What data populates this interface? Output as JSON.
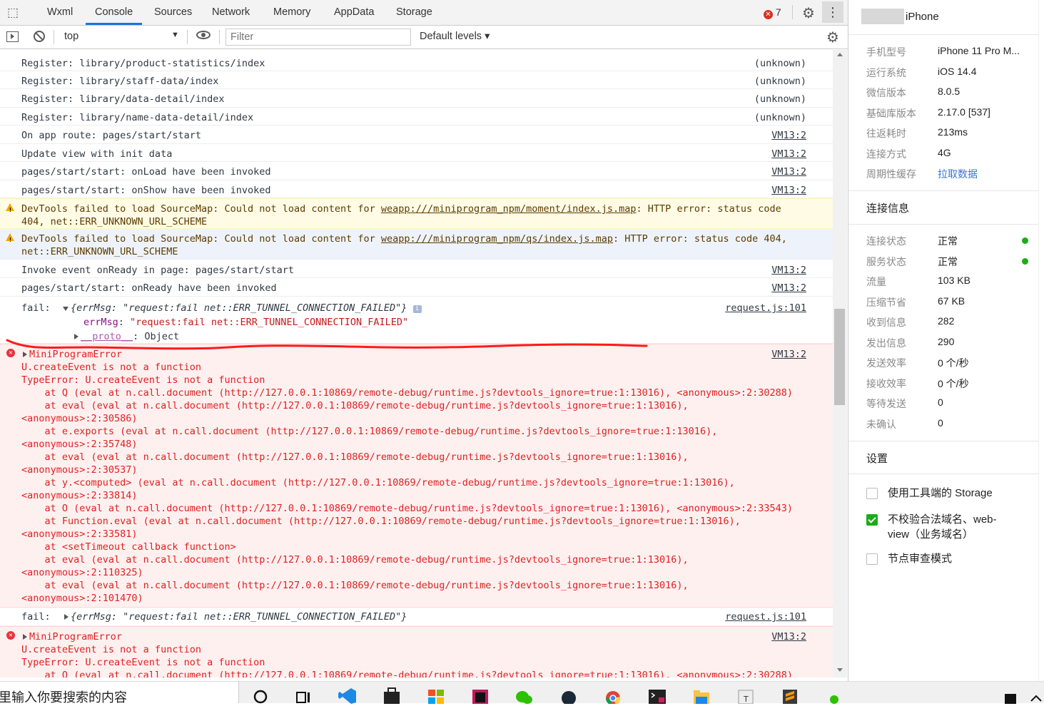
{
  "tabs": [
    "Wxml",
    "Console",
    "Sources",
    "Network",
    "Memory",
    "AppData",
    "Storage"
  ],
  "active_tab": "Console",
  "error_count": "7",
  "toolbar": {
    "context": "top",
    "filter_placeholder": "Filter",
    "levels": "Default levels"
  },
  "rows": {
    "r1": {
      "msg": "Register: library/product-statistics/index",
      "src": "(unknown)"
    },
    "r2": {
      "msg": "Register: library/staff-data/index",
      "src": "(unknown)"
    },
    "r3": {
      "msg": "Register: library/data-detail/index",
      "src": "(unknown)"
    },
    "r4": {
      "msg": "Register: library/name-data-detail/index",
      "src": "(unknown)"
    },
    "r5": {
      "msg": "On app route: pages/start/start",
      "src": "VM13:2"
    },
    "r6": {
      "msg": "Update view with init data",
      "src": "VM13:2"
    },
    "r7": {
      "msg": "pages/start/start: onLoad have been invoked",
      "src": "VM13:2"
    },
    "r8": {
      "msg": "pages/start/start: onShow have been invoked",
      "src": "VM13:2"
    },
    "w1": {
      "pre": "DevTools failed to load SourceMap: Could not load content for ",
      "link": "weapp:///miniprogram_npm/moment/index.js.map",
      "post": ": HTTP error: status code",
      "line2": "404, net::ERR_UNKNOWN_URL_SCHEME"
    },
    "w2": {
      "pre": "DevTools failed to load SourceMap: Could not load content for ",
      "link": "weapp:///miniprogram_npm/qs/index.js.map",
      "post": ": HTTP error: status code 404,",
      "line2": "net::ERR_UNKNOWN_URL_SCHEME"
    },
    "r9": {
      "msg": "Invoke event onReady in page: pages/start/start",
      "src": "VM13:2"
    },
    "r10": {
      "msg": "pages/start/start: onReady have been invoked",
      "src": "VM13:2"
    },
    "fail1": {
      "label": "fail:",
      "summary": "{errMsg: \"request:fail net::ERR_TUNNEL_CONNECTION_FAILED\"}",
      "key": "errMsg",
      "value": "\"request:fail net::ERR_TUNNEL_CONNECTION_FAILED\"",
      "proto": "__proto__",
      "proto_val": ": Object",
      "info": "i",
      "src": "request.js:101"
    },
    "err1": {
      "title": "MiniProgramError",
      "src": "VM13:2",
      "lines": [
        "U.createEvent is not a function",
        "TypeError: U.createEvent is not a function",
        "    at Q (eval at n.call.document (http://127.0.0.1:10869/remote-debug/runtime.js?devtools_ignore=true:1:13016), <anonymous>:2:30288)",
        "    at eval (eval at n.call.document (http://127.0.0.1:10869/remote-debug/runtime.js?devtools_ignore=true:1:13016),",
        "<anonymous>:2:30586)",
        "    at e.exports (eval at n.call.document (http://127.0.0.1:10869/remote-debug/runtime.js?devtools_ignore=true:1:13016),",
        "<anonymous>:2:35748)",
        "    at eval (eval at n.call.document (http://127.0.0.1:10869/remote-debug/runtime.js?devtools_ignore=true:1:13016),",
        "<anonymous>:2:30537)",
        "    at y.<computed> (eval at n.call.document (http://127.0.0.1:10869/remote-debug/runtime.js?devtools_ignore=true:1:13016),",
        "<anonymous>:2:33814)",
        "    at O (eval at n.call.document (http://127.0.0.1:10869/remote-debug/runtime.js?devtools_ignore=true:1:13016), <anonymous>:2:33543)",
        "    at Function.eval (eval at n.call.document (http://127.0.0.1:10869/remote-debug/runtime.js?devtools_ignore=true:1:13016),",
        "<anonymous>:2:33581)",
        "    at <setTimeout callback function>",
        "    at eval (eval at n.call.document (http://127.0.0.1:10869/remote-debug/runtime.js?devtools_ignore=true:1:13016),",
        "<anonymous>:2:110325)",
        "    at eval (eval at n.call.document (http://127.0.0.1:10869/remote-debug/runtime.js?devtools_ignore=true:1:13016),",
        "<anonymous>:2:101470)"
      ]
    },
    "fail2": {
      "label": "fail:",
      "summary": "{errMsg: \"request:fail net::ERR_TUNNEL_CONNECTION_FAILED\"}",
      "src": "request.js:101"
    },
    "err2": {
      "title": "MiniProgramError",
      "src": "VM13:2",
      "lines": [
        "U.createEvent is not a function",
        "TypeError: U.createEvent is not a function",
        "    at Q (eval at n.call.document (http://127.0.0.1:10869/remote-debug/runtime.js?devtools_ignore=true:1:13016), <anonymous>:2:30288)"
      ]
    }
  },
  "device": {
    "name": "iPhone"
  },
  "device_info": [
    {
      "k": "手机型号",
      "v": "iPhone 11 Pro M..."
    },
    {
      "k": "运行系统",
      "v": "iOS 14.4"
    },
    {
      "k": "微信版本",
      "v": "8.0.5"
    },
    {
      "k": "基础库版本",
      "v": "2.17.0 [537]"
    },
    {
      "k": "往返耗时",
      "v": "213ms"
    },
    {
      "k": "连接方式",
      "v": "4G"
    },
    {
      "k": "周期性缓存",
      "v": "拉取数据"
    }
  ],
  "conn_title": "连接信息",
  "conn_info": [
    {
      "k": "连接状态",
      "v": "正常"
    },
    {
      "k": "服务状态",
      "v": "正常"
    },
    {
      "k": "流量",
      "v": "103 KB"
    },
    {
      "k": "压缩节省",
      "v": "67 KB"
    },
    {
      "k": "收到信息",
      "v": "282"
    },
    {
      "k": "发出信息",
      "v": "290"
    },
    {
      "k": "发送效率",
      "v": "0 个/秒"
    },
    {
      "k": "接收效率",
      "v": "0 个/秒"
    },
    {
      "k": "等待发送",
      "v": "0"
    },
    {
      "k": "未确认",
      "v": "0"
    }
  ],
  "settings_title": "设置",
  "settings": [
    {
      "label": "使用工具端的 Storage",
      "checked": false
    },
    {
      "label": "不校验合法域名、web-view（业务域名）",
      "checked": true
    },
    {
      "label": "节点审查模式",
      "checked": false
    }
  ],
  "taskbar": {
    "search_text": "里输入你要搜索的内容"
  },
  "colors": {
    "accent": "#1a73e8",
    "error": "#e01f1f",
    "success": "#1aad19",
    "link": "#3576d0",
    "annotation": "#ff1a1a"
  }
}
